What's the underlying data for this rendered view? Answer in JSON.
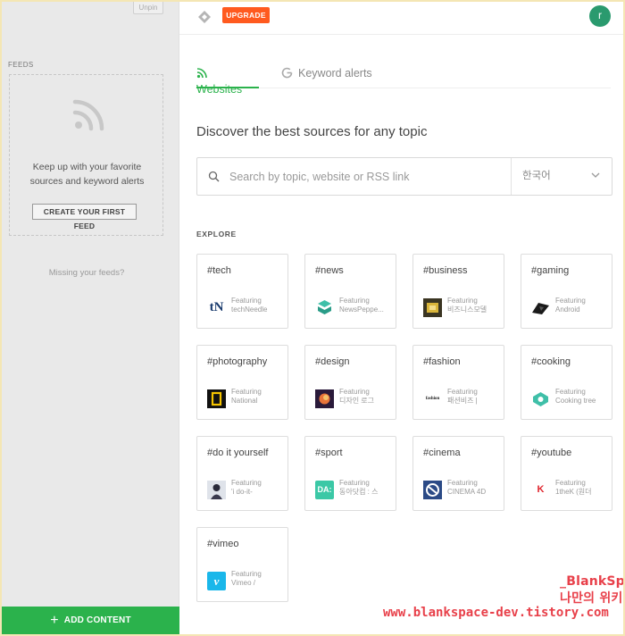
{
  "sidebar": {
    "unpin_label": "Unpin",
    "feeds_label": "FEEDS",
    "empty_message": "Keep up with your favorite sources and keyword alerts",
    "create_feed_label": "CREATE YOUR FIRST FEED",
    "missing_feeds": "Missing your feeds?",
    "add_content_label": "ADD CONTENT"
  },
  "header": {
    "upgrade_label": "UPGRADE",
    "avatar_initial": "r"
  },
  "tabs": [
    {
      "label": "Websites",
      "icon": "rss-icon",
      "active": true
    },
    {
      "label": "Keyword alerts",
      "icon": "google-icon",
      "active": false
    }
  ],
  "main": {
    "heading": "Discover the best sources for any topic",
    "search_placeholder": "Search by topic, website or RSS link",
    "language": "한국어",
    "explore_label": "EXPLORE"
  },
  "cards": [
    {
      "tag": "#tech",
      "featuring": "Featuring",
      "source": "techNeedle",
      "thumb": "tN"
    },
    {
      "tag": "#news",
      "featuring": "Featuring",
      "source": "NewsPeppe...",
      "thumb": ""
    },
    {
      "tag": "#business",
      "featuring": "Featuring",
      "source": "비즈니스모델",
      "thumb": ""
    },
    {
      "tag": "#gaming",
      "featuring": "Featuring",
      "source": "Android",
      "thumb": ""
    },
    {
      "tag": "#photography",
      "featuring": "Featuring",
      "source": "National",
      "thumb": ""
    },
    {
      "tag": "#design",
      "featuring": "Featuring",
      "source": "디자인 로그",
      "thumb": ""
    },
    {
      "tag": "#fashion",
      "featuring": "Featuring",
      "source": "패션비즈 |",
      "thumb": "fashion"
    },
    {
      "tag": "#cooking",
      "featuring": "Featuring",
      "source": "Cooking tree",
      "thumb": ""
    },
    {
      "tag": "#do it yourself",
      "featuring": "Featuring",
      "source": "'i do-it-",
      "thumb": ""
    },
    {
      "tag": "#sport",
      "featuring": "Featuring",
      "source": "동아닷컴 : 스",
      "thumb": "DA:"
    },
    {
      "tag": "#cinema",
      "featuring": "Featuring",
      "source": "CINEMA 4D",
      "thumb": ""
    },
    {
      "tag": "#youtube",
      "featuring": "Featuring",
      "source": "1theK (원더",
      "thumb": "K"
    },
    {
      "tag": "#vimeo",
      "featuring": "Featuring",
      "source": "Vimeo /",
      "thumb": "v"
    }
  ],
  "watermark": {
    "line1": "_BlankSpace 나만의 위키백과",
    "line2": "www.blankspace-dev.tistory.com"
  },
  "colors": {
    "accent_green": "#2bb24c",
    "upgrade_orange": "#ff5a1f",
    "avatar_green": "#2a9a6e",
    "watermark_red": "#e8404a"
  }
}
